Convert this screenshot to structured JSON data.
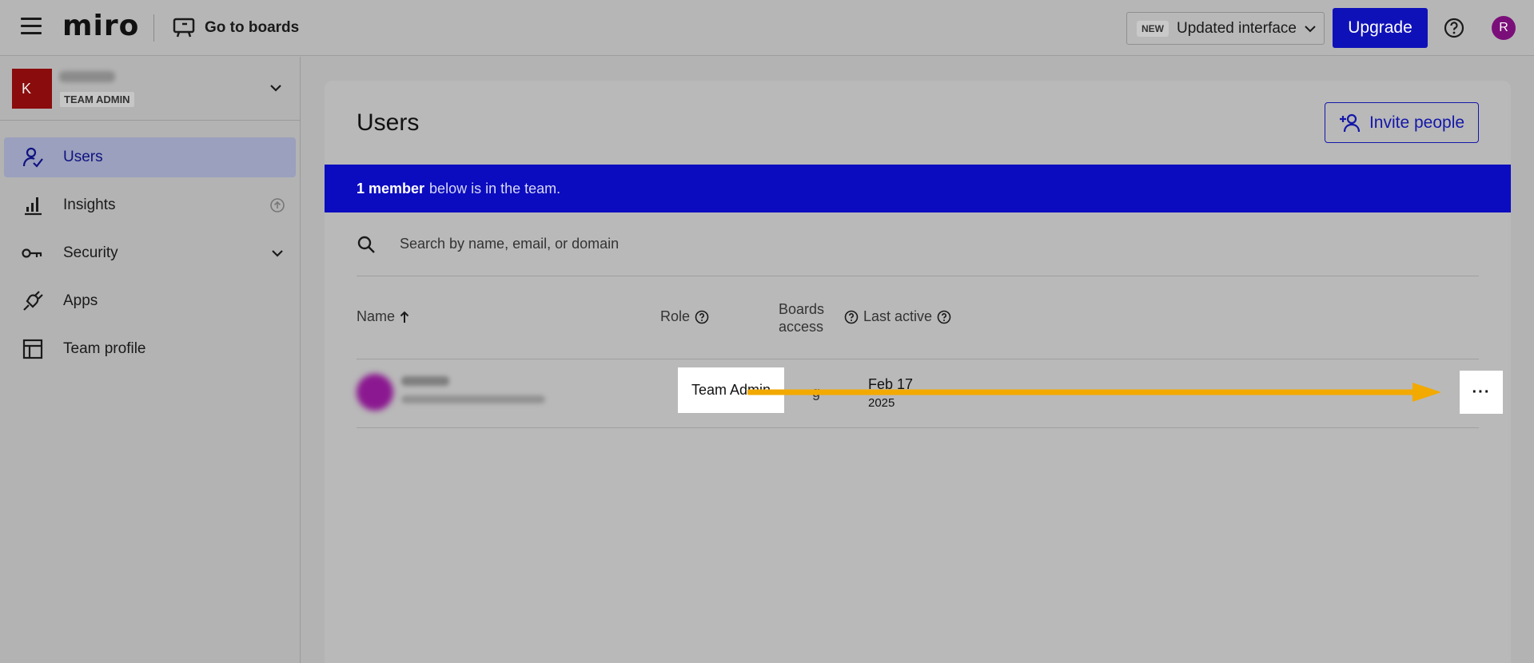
{
  "header": {
    "logo": "miro",
    "go_to_boards": "Go to boards",
    "new_badge": "NEW",
    "interface_label": "Updated interface",
    "upgrade_label": "Upgrade",
    "avatar_initial": "R"
  },
  "team": {
    "logo_text": "K",
    "role": "TEAM ADMIN"
  },
  "sidebar": {
    "items": [
      {
        "label": "Users",
        "icon": "user-check-icon"
      },
      {
        "label": "Insights",
        "icon": "bar-chart-icon"
      },
      {
        "label": "Security",
        "icon": "key-icon"
      },
      {
        "label": "Apps",
        "icon": "plug-icon"
      },
      {
        "label": "Team profile",
        "icon": "layout-icon"
      }
    ]
  },
  "main": {
    "title": "Users",
    "invite_label": "Invite people",
    "banner_count": "1 member",
    "banner_text": "below is in the team.",
    "search_placeholder": "Search by name, email, or domain",
    "columns": {
      "name": "Name",
      "role": "Role",
      "boards_line1": "Boards",
      "boards_line2": "access",
      "last_active": "Last active"
    },
    "rows": [
      {
        "role": "Team Admin",
        "boards_access": "g",
        "last_active_date": "Feb 17",
        "last_active_year": "2025",
        "more_label": "···"
      }
    ]
  },
  "colors": {
    "accent": "#0f11b8",
    "banner": "#0b0cbf",
    "arrow": "#f2a900",
    "avatar": "#7b0f7a"
  }
}
